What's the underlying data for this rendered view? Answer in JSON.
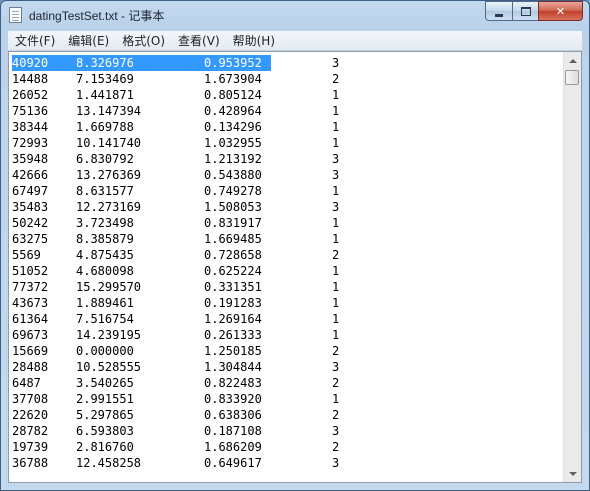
{
  "window": {
    "title": "datingTestSet.txt - 记事本",
    "controls": {
      "minimize_icon": "minimize-icon",
      "maximize_icon": "maximize-icon",
      "close_icon": "close-icon",
      "close_label": "✕"
    }
  },
  "menu": [
    "文件(F)",
    "编辑(E)",
    "格式(O)",
    "查看(V)",
    "帮助(H)"
  ],
  "editor": {
    "selection_color": "#3399ff",
    "rows": [
      [
        "40920",
        "8.326976",
        "0.953952",
        "3"
      ],
      [
        "14488",
        "7.153469",
        "1.673904",
        "2"
      ],
      [
        "26052",
        "1.441871",
        "0.805124",
        "1"
      ],
      [
        "75136",
        "13.147394",
        "0.428964",
        "1"
      ],
      [
        "38344",
        "1.669788",
        "0.134296",
        "1"
      ],
      [
        "72993",
        "10.141740",
        "1.032955",
        "1"
      ],
      [
        "35948",
        "6.830792",
        "1.213192",
        "3"
      ],
      [
        "42666",
        "13.276369",
        "0.543880",
        "3"
      ],
      [
        "67497",
        "8.631577",
        "0.749278",
        "1"
      ],
      [
        "35483",
        "12.273169",
        "1.508053",
        "3"
      ],
      [
        "50242",
        "3.723498",
        "0.831917",
        "1"
      ],
      [
        "63275",
        "8.385879",
        "1.669485",
        "1"
      ],
      [
        "5569",
        "4.875435",
        "0.728658",
        "2"
      ],
      [
        "51052",
        "4.680098",
        "0.625224",
        "1"
      ],
      [
        "77372",
        "15.299570",
        "0.331351",
        "1"
      ],
      [
        "43673",
        "1.889461",
        "0.191283",
        "1"
      ],
      [
        "61364",
        "7.516754",
        "1.269164",
        "1"
      ],
      [
        "69673",
        "14.239195",
        "0.261333",
        "1"
      ],
      [
        "15669",
        "0.000000",
        "1.250185",
        "2"
      ],
      [
        "28488",
        "10.528555",
        "1.304844",
        "3"
      ],
      [
        "6487",
        "3.540265",
        "0.822483",
        "2"
      ],
      [
        "37708",
        "2.991551",
        "0.833920",
        "1"
      ],
      [
        "22620",
        "5.297865",
        "0.638306",
        "2"
      ],
      [
        "28782",
        "6.593803",
        "0.187108",
        "3"
      ],
      [
        "19739",
        "2.816760",
        "1.686209",
        "2"
      ],
      [
        "36788",
        "12.458258",
        "0.649617",
        "3"
      ]
    ]
  }
}
